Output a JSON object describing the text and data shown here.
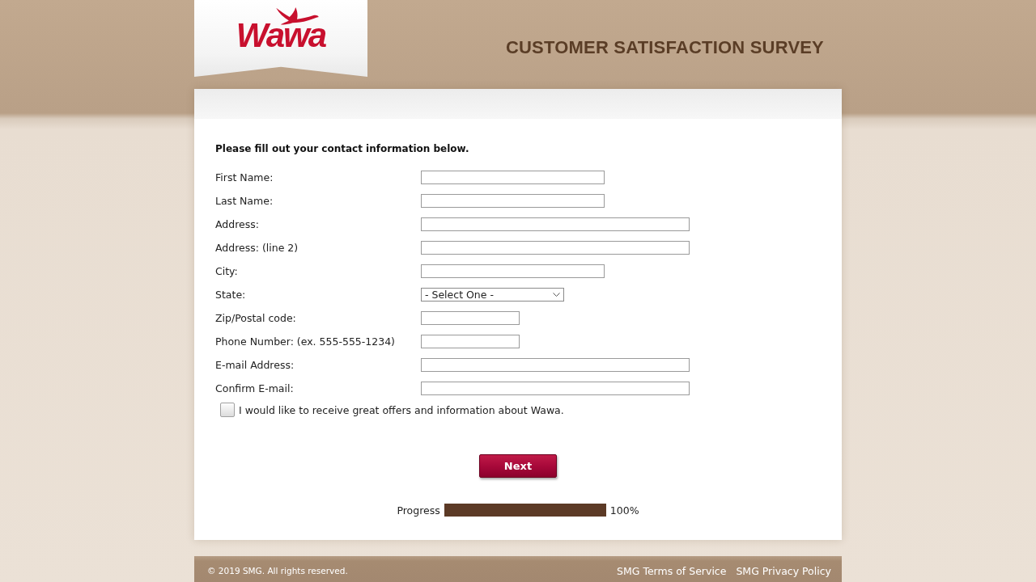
{
  "header": {
    "logo": "Wawa",
    "title": "CUSTOMER SATISFACTION SURVEY"
  },
  "form": {
    "instruction": "Please fill out your contact information below.",
    "fields": [
      {
        "label": "First Name:",
        "kind": "text"
      },
      {
        "label": "Last Name:",
        "kind": "text"
      },
      {
        "label": "Address:",
        "kind": "text"
      },
      {
        "label": "Address: (line 2)",
        "kind": "text"
      },
      {
        "label": "City:",
        "kind": "text"
      },
      {
        "label": "State:",
        "kind": "select",
        "value": "- Select One -"
      },
      {
        "label": "Zip/Postal code:",
        "kind": "text"
      },
      {
        "label": "Phone Number: (ex. 555-555-1234)",
        "kind": "text"
      },
      {
        "label": "E-mail Address:",
        "kind": "text"
      },
      {
        "label": "Confirm E-mail:",
        "kind": "text"
      }
    ],
    "consent": {
      "label": "I would like to receive great offers and information about Wawa.",
      "checked": false
    }
  },
  "next_button": "Next",
  "progress": {
    "label": "Progress",
    "level": 1,
    "reading": "100%"
  },
  "footer": {
    "copyright": "© 2019 SMG. All rights reserved.",
    "links": [
      "SMG Terms of Service",
      "SMG Privacy Policy"
    ]
  }
}
